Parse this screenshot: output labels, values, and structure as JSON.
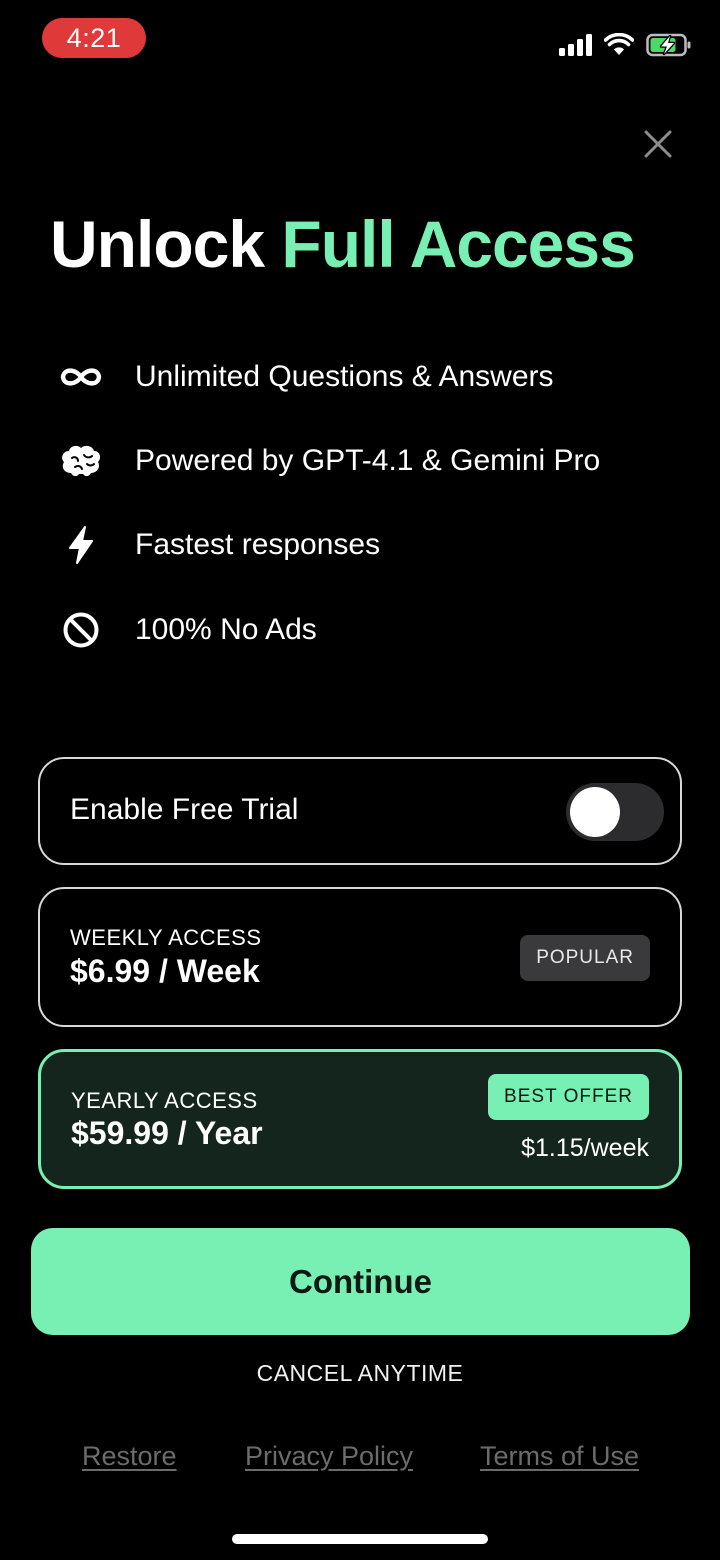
{
  "status_bar": {
    "time": "4:21",
    "icons": [
      "signal-icon",
      "wifi-icon",
      "battery-charging-icon"
    ]
  },
  "header": {
    "close_icon": "close-icon"
  },
  "title": {
    "prefix": "Unlock",
    "accent": "Full Access"
  },
  "features": [
    {
      "icon": "infinity-icon",
      "label": "Unlimited Questions & Answers"
    },
    {
      "icon": "brain-icon",
      "label": "Powered by GPT-4.1 & Gemini Pro"
    },
    {
      "icon": "lightning-icon",
      "label": "Fastest responses"
    },
    {
      "icon": "no-ads-icon",
      "label": "100% No Ads"
    }
  ],
  "trial": {
    "label": "Enable Free Trial",
    "enabled": false
  },
  "plans": {
    "weekly": {
      "name": "WEEKLY ACCESS",
      "price": "$6.99 / Week",
      "badge": "POPULAR",
      "selected": false
    },
    "yearly": {
      "name": "YEARLY ACCESS",
      "price": "$59.99 / Year",
      "badge": "BEST OFFER",
      "per_week": "$1.15/week",
      "selected": true
    }
  },
  "cta": {
    "continue_label": "Continue",
    "cancel_note": "CANCEL ANYTIME"
  },
  "footer": {
    "restore": "Restore",
    "privacy": "Privacy Policy",
    "terms": "Terms of Use"
  },
  "colors": {
    "background": "#000000",
    "accent": "#78f0b4",
    "status_time_bg": "#e0393a",
    "selected_card_bg": "#14251d",
    "footer_link": "#6b6b6b"
  }
}
